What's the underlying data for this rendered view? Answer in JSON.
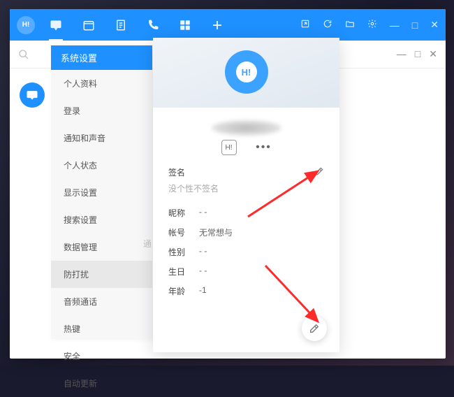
{
  "titlebar": {
    "logo_text": "H!"
  },
  "settings": {
    "title": "系统设置",
    "items": [
      "个人资料",
      "登录",
      "通知和声音",
      "个人状态",
      "显示设置",
      "搜索设置",
      "数据管理",
      "防打扰",
      "音频通话",
      "热键",
      "安全",
      "自动更新"
    ],
    "active_index": 7
  },
  "profile": {
    "avatar_text": "H!",
    "msg_label": "H!",
    "signature_label": "签名",
    "signature_placeholder": "没个性不签名",
    "partial_label": "通",
    "fields": {
      "nickname": {
        "label": "昵称",
        "value": "- -"
      },
      "account": {
        "label": "帐号",
        "value": "无常想与"
      },
      "gender": {
        "label": "性别",
        "value": "- -"
      },
      "birthday": {
        "label": "生日",
        "value": "- -"
      },
      "age": {
        "label": "年龄",
        "value": "-1"
      }
    }
  }
}
